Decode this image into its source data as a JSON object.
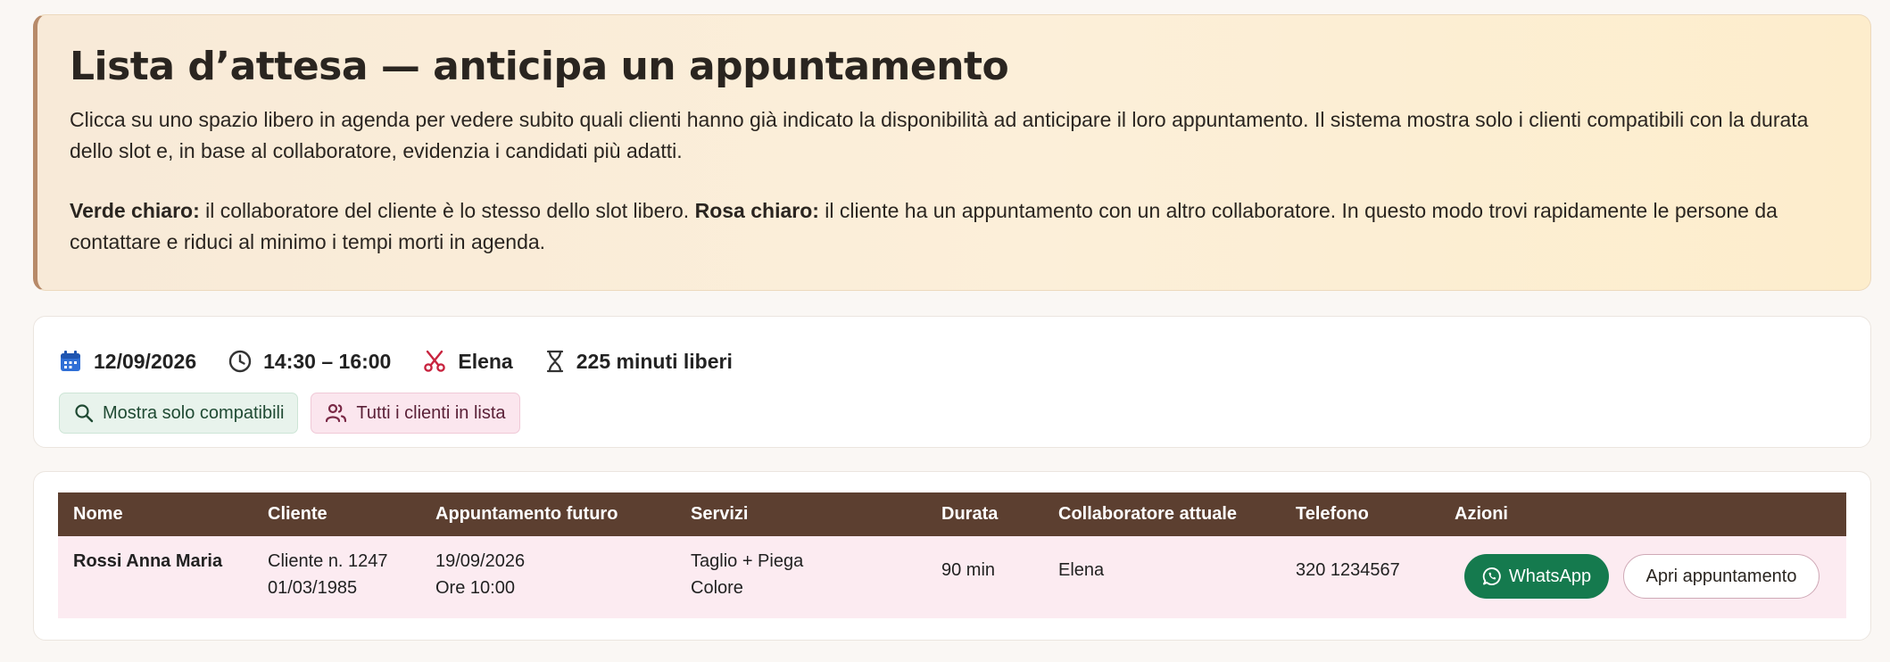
{
  "hero": {
    "title": "Lista d’attesa — anticipa un appuntamento",
    "description": "Clicca su uno spazio libero in agenda per vedere subito quali clienti hanno già indicato la disponibilità ad anticipare il loro appuntamento. Il sistema mostra solo i clienti compatibili con la durata dello slot e, in base al collaboratore, evidenzia i candidati più adatti.",
    "legend_green_label": "Verde chiaro:",
    "legend_green_text": " il collaboratore del cliente è lo stesso dello slot libero. ",
    "legend_pink_label": "Rosa chiaro:",
    "legend_pink_text": " il cliente ha un appuntamento con un altro collaboratore. In questo modo trovi rapidamente le persone da contattare e riduci al minimo i tempi morti in agenda."
  },
  "slot": {
    "date": "12/09/2026",
    "time": "14:30 – 16:00",
    "collaborator": "Elena",
    "free_minutes": "225 minuti liberi"
  },
  "filters": {
    "compatible_label": "Mostra solo compatibili",
    "all_label": "Tutti i clienti in lista"
  },
  "table": {
    "columns": [
      "Nome",
      "Cliente",
      "Appuntamento futuro",
      "Servizi",
      "Durata",
      "Collaboratore attuale",
      "Telefono",
      "Azioni"
    ],
    "rows": [
      {
        "name": "Rossi Anna Maria",
        "client_no": "Cliente n. 1247",
        "birth": "01/03/1985",
        "appt_date": "19/09/2026",
        "appt_time": "Ore 10:00",
        "service_1": "Taglio + Piega",
        "service_2": "Colore",
        "duration": "90 min",
        "collaborator": "Elena",
        "phone": "320 1234567",
        "whatsapp_label": "WhatsApp",
        "open_label": "Apri appuntamento"
      }
    ]
  },
  "colors": {
    "accent_brown": "#5c3f30",
    "whatsapp_green": "#157a4e",
    "row_pink": "#fcebf1",
    "chip_green": "#e8f3ec",
    "chip_pink": "#fbe6ee"
  },
  "icons": [
    "calendar-icon",
    "clock-icon",
    "scissors-icon",
    "hourglass-icon",
    "search-icon",
    "users-icon",
    "whatsapp-icon"
  ]
}
